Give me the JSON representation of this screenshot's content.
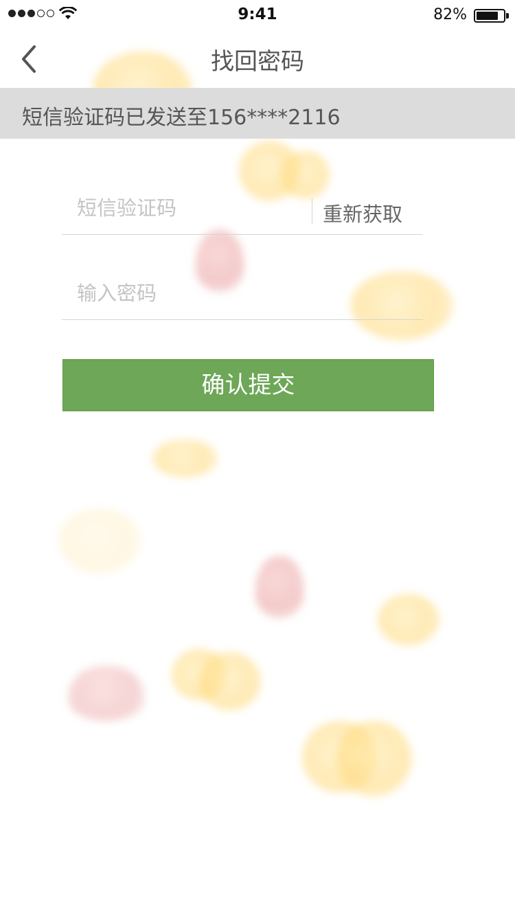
{
  "status_bar": {
    "time": "9:41",
    "battery_percent": "82%",
    "battery_level": 0.82,
    "signal_bars_filled": 3,
    "signal_bars_total": 5
  },
  "nav": {
    "title": "找回密码",
    "back_icon": "chevron-left-icon"
  },
  "info": {
    "message": "短信验证码已发送至156****2116"
  },
  "form": {
    "sms_code_placeholder": "短信验证码",
    "resend_label": "重新获取",
    "password_placeholder": "输入密码",
    "submit_label": "确认提交"
  },
  "colors": {
    "accent": "#6da757",
    "info_strip": "#dcdcdc"
  }
}
